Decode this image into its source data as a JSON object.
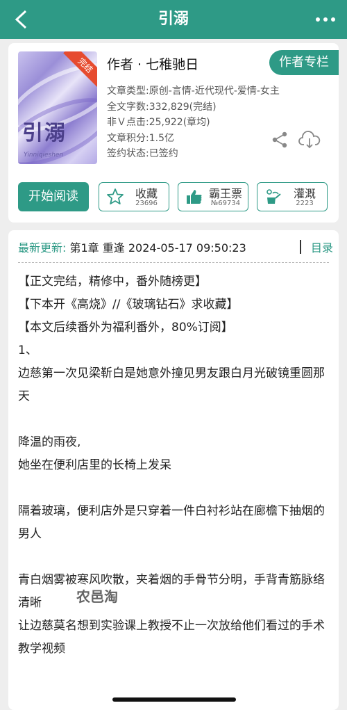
{
  "header": {
    "title": "引溺"
  },
  "book": {
    "cover_title": "引溺",
    "cover_subtitle": "Yinniqieshen",
    "ribbon": "完结",
    "author": "作者 · 七稚驰日",
    "author_column_label": "作者专栏",
    "meta": [
      "文章类型:原创-言情-近代现代-爱情-女主",
      "全文字数:332,829(完结)",
      "非Ｖ点击:25,922(章均)",
      "文章积分:1.5亿",
      "签约状态:已签约"
    ]
  },
  "actions": {
    "read_label": "开始阅读",
    "buttons": [
      {
        "label": "收藏",
        "count": "23696",
        "icon": "star-icon"
      },
      {
        "label": "霸王票",
        "count": "№69734",
        "icon": "thumbs-up-icon"
      },
      {
        "label": "灌溉",
        "count": "2223",
        "icon": "watering-can-icon"
      }
    ]
  },
  "update": {
    "label": "最新更新:",
    "text": " 第1章 重逢 2024-05-17 09:50:23",
    "toc_label": "目录"
  },
  "content": {
    "lines": [
      "【正文完结，精修中，番外随榜更】",
      "【下本开《高烧》//《玻璃钻石》求收藏】",
      "【本文后续番外为福利番外，80%订阅】",
      "1、",
      "边慈第一次见梁靳白是她意外撞见男友跟白月光破镜重圆那天",
      "",
      "降温的雨夜,",
      "她坐在便利店里的长椅上发呆",
      "",
      "隔着玻璃，便利店外是只穿着一件白衬衫站在廊檐下抽烟的男人",
      "",
      "青白烟雾被寒风吹散，夹着烟的手骨节分明，手背青筋脉络清晰",
      "让边慈莫名想到实验课上教授不止一次放给他们看过的手术教学视频"
    ]
  },
  "watermark": "农邑淘",
  "colors": {
    "accent": "#2e9a86",
    "ribbon": "#e64b2f"
  }
}
